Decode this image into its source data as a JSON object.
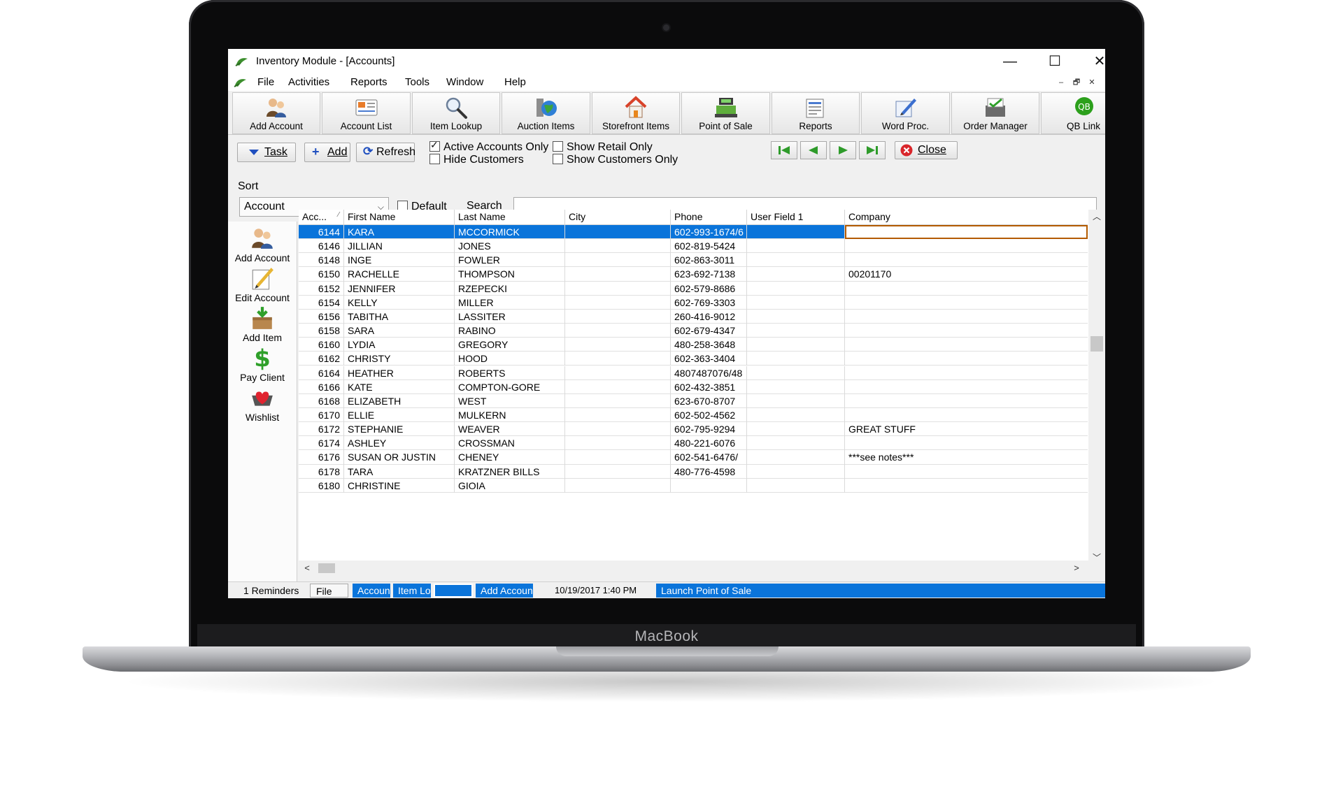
{
  "device": {
    "brand": "MacBook"
  },
  "window": {
    "title": "Inventory Module - [Accounts]",
    "controls": {
      "minimize": "—",
      "maximize": "☐",
      "close": "✕"
    }
  },
  "menu": [
    "File",
    "Activities",
    "Reports",
    "Tools",
    "Window",
    "Help"
  ],
  "mdi_controls": {
    "minimize": "–",
    "restore": "🗗",
    "close": "✕"
  },
  "toolbar": [
    {
      "label": "Add Account",
      "icon": "add-account-icon"
    },
    {
      "label": "Account List",
      "icon": "account-list-icon"
    },
    {
      "label": "Item Lookup",
      "icon": "magnifier-icon"
    },
    {
      "label": "Auction Items",
      "icon": "globe-icon"
    },
    {
      "label": "Storefront Items",
      "icon": "house-icon"
    },
    {
      "label": "Point of Sale",
      "icon": "cash-register-icon"
    },
    {
      "label": "Reports",
      "icon": "reports-icon"
    },
    {
      "label": "Word Proc.",
      "icon": "word-processor-icon"
    },
    {
      "label": "Order Manager",
      "icon": "order-manager-icon"
    },
    {
      "label": "QB Link",
      "icon": "quickbooks-icon"
    }
  ],
  "actions": {
    "task": "Task",
    "add": "Add",
    "refresh": "Refresh",
    "close": "Close"
  },
  "filters": {
    "active_accounts_only": {
      "label": "Active Accounts Only",
      "checked": true
    },
    "hide_customers": {
      "label": "Hide Customers",
      "checked": false
    },
    "show_retail_only": {
      "label": "Show Retail Only",
      "checked": false
    },
    "show_customers_only": {
      "label": "Show Customers Only",
      "checked": false
    }
  },
  "sort": {
    "label": "Sort",
    "value": "Account",
    "default_label": "Default",
    "default_checked": false
  },
  "search": {
    "label": "Search",
    "value": ""
  },
  "sidebar": [
    {
      "label": "Add Account",
      "icon": "add-account-icon"
    },
    {
      "label": "Edit Account",
      "icon": "pencil-icon"
    },
    {
      "label": "Add Item",
      "icon": "add-item-icon"
    },
    {
      "label": "Pay Client",
      "icon": "dollar-icon"
    },
    {
      "label": "Wishlist",
      "icon": "wishlist-icon"
    }
  ],
  "columns": [
    "Acc...",
    "First Name",
    "Last Name",
    "City",
    "Phone",
    "User Field 1",
    "Company"
  ],
  "rows": [
    [
      "6144",
      "KARA",
      "MCCORMICK",
      "",
      "602-993-1674/6",
      "",
      ""
    ],
    [
      "6146",
      "JILLIAN",
      "JONES",
      "",
      "602-819-5424",
      "",
      ""
    ],
    [
      "6148",
      "INGE",
      "FOWLER",
      "",
      "602-863-3011",
      "",
      ""
    ],
    [
      "6150",
      "RACHELLE",
      "THOMPSON",
      "",
      "623-692-7138",
      "",
      "00201170"
    ],
    [
      "6152",
      "JENNIFER",
      "RZEPECKI",
      "",
      "602-579-8686",
      "",
      ""
    ],
    [
      "6154",
      "KELLY",
      "MILLER",
      "",
      "602-769-3303",
      "",
      ""
    ],
    [
      "6156",
      "TABITHA",
      "LASSITER",
      "",
      "260-416-9012",
      "",
      ""
    ],
    [
      "6158",
      "SARA",
      "RABINO",
      "",
      "602-679-4347",
      "",
      ""
    ],
    [
      "6160",
      "LYDIA",
      "GREGORY",
      "",
      "480-258-3648",
      "",
      ""
    ],
    [
      "6162",
      "CHRISTY",
      "HOOD",
      "",
      "602-363-3404",
      "",
      ""
    ],
    [
      "6164",
      "HEATHER",
      "ROBERTS",
      "",
      "4807487076/48",
      "",
      ""
    ],
    [
      "6166",
      "KATE",
      "COMPTON-GORE",
      "",
      "602-432-3851",
      "",
      ""
    ],
    [
      "6168",
      "ELIZABETH",
      "WEST",
      "",
      "623-670-8707",
      "",
      ""
    ],
    [
      "6170",
      "ELLIE",
      "MULKERN",
      "",
      "602-502-4562",
      "",
      ""
    ],
    [
      "6172",
      "STEPHANIE",
      "WEAVER",
      "",
      "602-795-9294",
      "",
      "GREAT STUFF"
    ],
    [
      "6174",
      "ASHLEY",
      "CROSSMAN",
      "",
      "480-221-6076",
      "",
      ""
    ],
    [
      "6176",
      "SUSAN OR JUSTIN",
      "CHENEY",
      "",
      "602-541-6476/",
      "",
      "***see notes***"
    ],
    [
      "6178",
      "TARA",
      "KRATZNER BILLS",
      "",
      "480-776-4598",
      "",
      ""
    ],
    [
      "6180",
      "CHRISTINE",
      "GIOIA",
      "",
      "",
      "",
      ""
    ]
  ],
  "selected_row": 0,
  "statusbar": {
    "reminders": "1 Reminders",
    "file": "File",
    "account": "Accoun",
    "item_lookup": "Item Lo",
    "blank": "",
    "add_account": "Add Accoun",
    "datetime": "10/19/2017 1:40 PM",
    "launch": "Launch Point of Sale"
  },
  "colors": {
    "selection": "#0a74da",
    "status_blue": "#0a74da",
    "close_red": "#d9262b"
  }
}
